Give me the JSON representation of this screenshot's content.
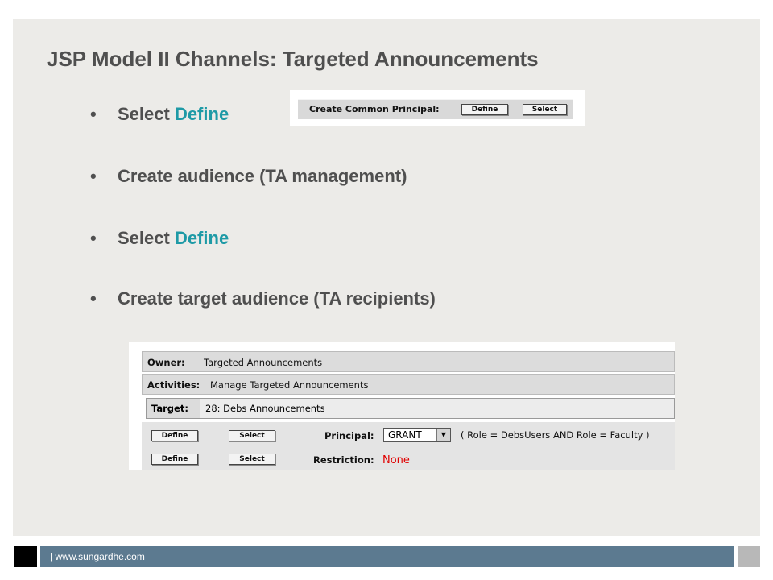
{
  "title": "JSP Model II Channels: Targeted Announcements",
  "bullets": [
    {
      "dot": "•",
      "pre": "Select ",
      "hl": "Define"
    },
    {
      "dot": "•",
      "text": "Create audience (TA management)"
    },
    {
      "dot": "•",
      "pre": "Select ",
      "hl": "Define"
    },
    {
      "dot": "•",
      "text": "Create target audience (TA recipients)"
    }
  ],
  "shot1": {
    "label": "Create Common Principal:",
    "define": "Define",
    "select": "Select"
  },
  "shot2": {
    "owner_key": "Owner:",
    "owner_val": "Targeted Announcements",
    "activities_key": "Activities:",
    "activities_val": "Manage Targeted Announcements",
    "target_key": "Target:",
    "target_val": "28: Debs Announcements",
    "define": "Define",
    "select": "Select",
    "principal_label": "Principal:",
    "principal_value": "GRANT",
    "principal_arrow": "▼",
    "principal_expr": "( Role = DebsUsers AND Role = Faculty )",
    "restriction_label": "Restriction:",
    "restriction_value": "None"
  },
  "footer": {
    "text": "| www.sungardhe.com"
  },
  "colors": {
    "accent": "#1e9aa6",
    "footer_bar": "#5c7a90",
    "none_red": "#e00000"
  }
}
